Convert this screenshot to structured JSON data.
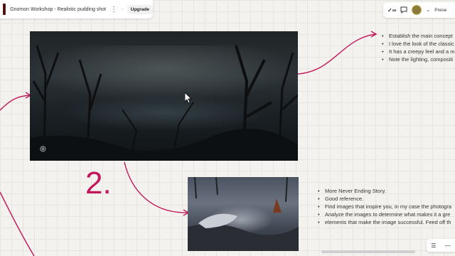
{
  "topbar": {
    "board_title": "Gnomon Workshop - Realistic pudding shot",
    "upgrade_label": "Upgrade",
    "present_label": "Prese",
    "reactions_label": "✓∞"
  },
  "canvas": {
    "big_number": "2.",
    "notes_top": [
      "Establish the main concept",
      "I love the look of the classic",
      "It has a creepy feel and a m",
      "Note the lighting, compositi"
    ],
    "notes_bottom": [
      "More Never Ending Story.",
      "Good reference.",
      "Find images that inspire you, in my case the photogra",
      "Analyze the images to determine what makes it a gre",
      "elements that make the image successful. Feed off th"
    ]
  },
  "colors": {
    "accent": "#c2185b",
    "canvas_bg": "#f3f2ef"
  },
  "icons": [
    "kebab-menu-icon",
    "share-icon",
    "comment-icon",
    "focus-icon",
    "cursor-icon",
    "list-icon",
    "minus-icon"
  ]
}
